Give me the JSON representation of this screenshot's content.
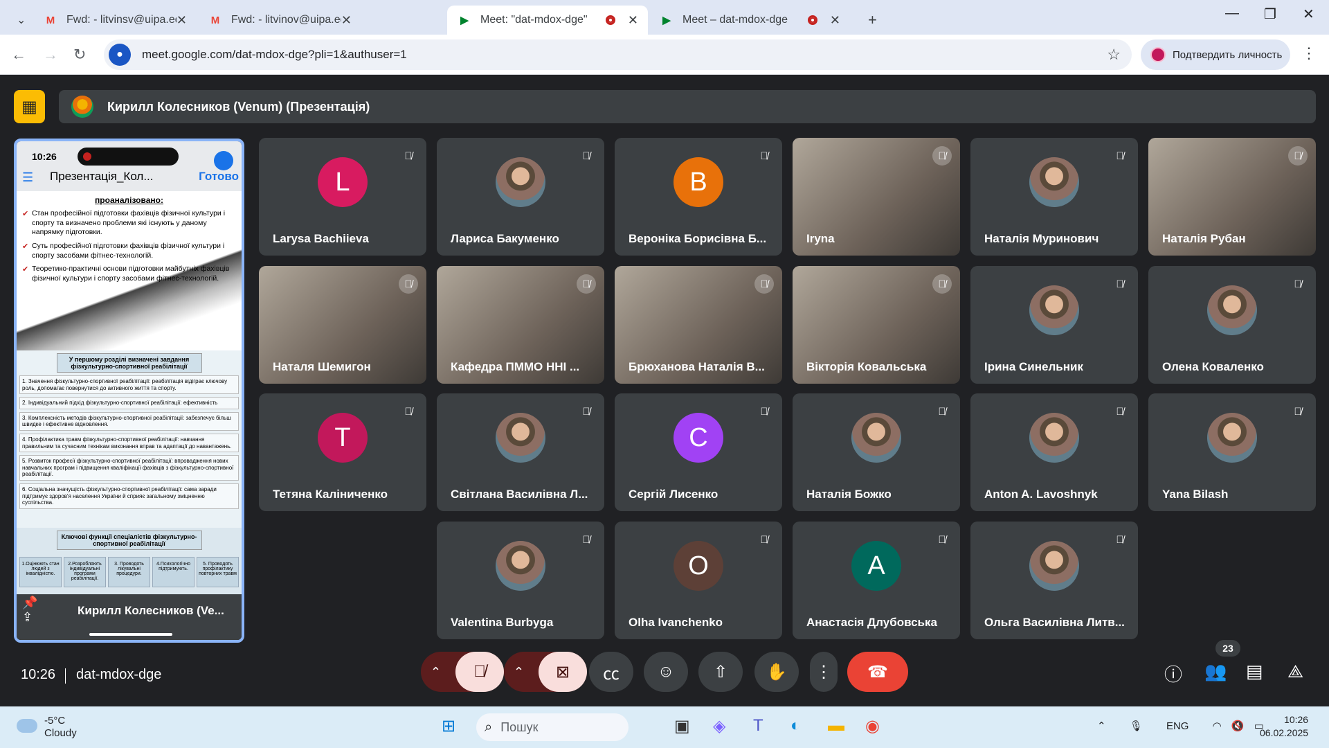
{
  "browser": {
    "tabs": [
      {
        "icon": "gmail-icon",
        "title": "Fwd: - litvinsv@uipa.edu.ua - по",
        "active": false
      },
      {
        "icon": "gmail-icon",
        "title": "Fwd: - litvinov@uipa.edu.ua - П",
        "active": false
      },
      {
        "icon": "meet-icon",
        "title": "Meet: \"dat-mdox-dge\"",
        "active": true
      },
      {
        "icon": "meet-icon",
        "title": "Meet – dat-mdox-dge",
        "active": false
      }
    ],
    "url": "meet.google.com/dat-mdox-dge?pli=1&authuser=1",
    "verify_label": "Подтвердить личность"
  },
  "presentation": {
    "banner": "Кирилл Колесников (Venum) (Презентація)",
    "presenter_name": "Кирилл Колесников (Ve...",
    "phone": {
      "time": "10:26",
      "doc_title": "Презентація_Кол...",
      "done_label": "Готово"
    },
    "slide1": {
      "title": "проаналізовано:",
      "items": [
        "Стан професійної підготовки фахівців фізичної культури і спорту та визначено проблеми які існують у даному напрямку підготовки.",
        "Суть професійної підготовки фахівців фізичної культури і спорту засобами фітнес-технологій.",
        "Теоретико-практичні основи підготовки майбутніх фахівців фізичної культури і спорту засобами фітнес-технологій."
      ]
    },
    "slide2": {
      "title": "У першому розділі визначені завдання фізкультурно-спортивної реабілітації",
      "items": [
        "1. Значення фізкультурно-спортивної реабілітації: реабілітація відіграє ключову роль, допомагає повернутися до активного життя та спорту.",
        "2. Індивідуальний підхід фізкультурно-спортивної реабілітації: ефективність",
        "3. Комплексність методів фізкультурно-спортивної реабілітації: забезпечує більш швидке і ефективне відновлення.",
        "4. Профілактика травм фізкультурно-спортивної реабілітації: навчання правильним та сучасним технікам виконання вправ та адаптації до навантажень.",
        "5. Розвиток професії фізкультурно-спортивної реабілітації: впровадження нових навчальних програм і підвищення кваліфікації фахівців з фізкультурно-спортивної реабілітації.",
        "6. Соціальна значущість фізкультурно-спортивної реабілітації: сама заради підтримує здоров'я населення України й сприяє загальному зміцненню суспільства."
      ]
    },
    "slide3": {
      "title": "Ключові функції спеціалістів фізкультурно-спортивної реабілітації",
      "cells": [
        "1.Оцінюють стан людей з інвалідністю.",
        "2.Розробляють індивідуальні програми реабілітації.",
        "3. Проводять лікувальні процедури.",
        "4.Психологічно підтримують.",
        "5. Проводять профілактику повторних травм"
      ]
    }
  },
  "participants": [
    {
      "name": "Larysa Bachiieva",
      "initial": "L",
      "color": "#d81b60",
      "kind": "initial"
    },
    {
      "name": "Лариса Бакуменко",
      "kind": "photo"
    },
    {
      "name": "Вероніка Борисівна Б...",
      "initial": "В",
      "color": "#e8710a",
      "kind": "initial"
    },
    {
      "name": "Iryna",
      "kind": "video"
    },
    {
      "name": "Наталія Муринович",
      "kind": "photo"
    },
    {
      "name": "Наталія Рубан",
      "kind": "video"
    },
    {
      "name": "Наталя Шемигон",
      "kind": "video"
    },
    {
      "name": "Кафедра ПММО ННІ ...",
      "kind": "video"
    },
    {
      "name": "Брюханова Наталія В...",
      "kind": "video"
    },
    {
      "name": "Вікторія Ковальська",
      "kind": "video"
    },
    {
      "name": "Ірина Синельник",
      "kind": "photo"
    },
    {
      "name": "Олена Коваленко",
      "kind": "photo"
    },
    {
      "name": "Тетяна Каліниченко",
      "initial": "Т",
      "color": "#c2185b",
      "kind": "initial"
    },
    {
      "name": "Світлана Василівна Л...",
      "kind": "photo"
    },
    {
      "name": "Сергій Лисенко",
      "initial": "С",
      "color": "#a142f4",
      "kind": "initial"
    },
    {
      "name": "Наталія Божко",
      "kind": "photo"
    },
    {
      "name": "Anton A. Lavoshnyk",
      "kind": "photo"
    },
    {
      "name": "Yana Bilash",
      "kind": "photo"
    },
    {
      "name": "Valentina Burbyga",
      "kind": "photo"
    },
    {
      "name": "Olha Ivanchenko",
      "initial": "O",
      "color": "#5d4037",
      "kind": "initial"
    },
    {
      "name": "Анастасія Длубовська",
      "initial": "A",
      "color": "#00695c",
      "kind": "initial"
    },
    {
      "name": "Ольга Василівна Литв...",
      "kind": "photo"
    }
  ],
  "meeting": {
    "time": "10:26",
    "code": "dat-mdox-dge",
    "participant_count": "23"
  },
  "taskbar": {
    "weather_temp": "-5°C",
    "weather_desc": "Cloudy",
    "search_label": "Пошук",
    "lang": "ENG",
    "time": "10:26",
    "date": "06.02.2025"
  }
}
